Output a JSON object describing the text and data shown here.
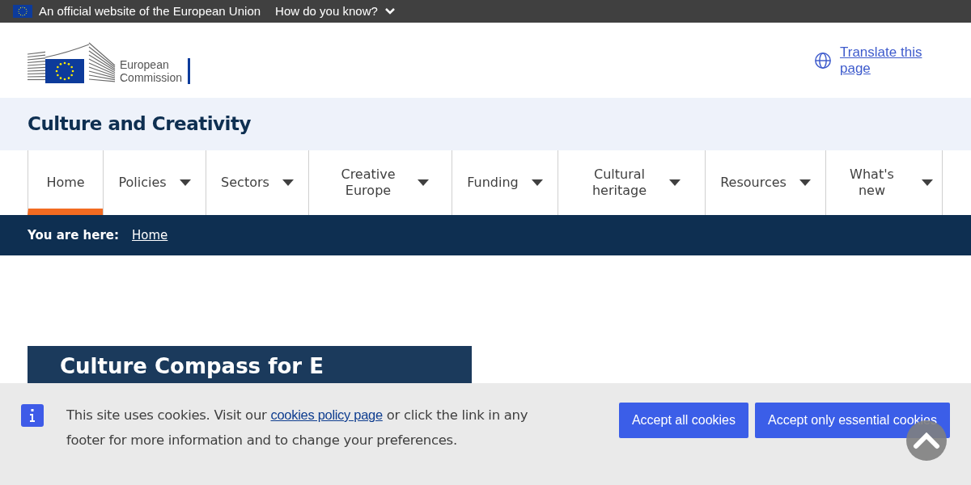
{
  "top_bar": {
    "text": "An official website of the European Union",
    "toggle": "How do you know?"
  },
  "header": {
    "logo_text": [
      "European",
      "Commission"
    ],
    "translate_link": "Translate this page"
  },
  "site_name": "Culture and Creativity",
  "nav": [
    {
      "label": "Home",
      "selected": true,
      "dropdown": false
    },
    {
      "label": "Policies",
      "selected": false,
      "dropdown": true
    },
    {
      "label": "Sectors",
      "selected": false,
      "dropdown": true
    },
    {
      "label": "Creative Europe",
      "selected": false,
      "dropdown": true
    },
    {
      "label": "Funding",
      "selected": false,
      "dropdown": true
    },
    {
      "label": "Cultural heritage",
      "selected": false,
      "dropdown": true
    },
    {
      "label": "Resources",
      "selected": false,
      "dropdown": true
    },
    {
      "label": "What's new",
      "selected": false,
      "dropdown": true
    }
  ],
  "breadcrumb": {
    "label": "You are here:",
    "items": [
      "Home"
    ]
  },
  "hero": {
    "title": "Culture Compass for E"
  },
  "cookie_banner": {
    "text_before": "This site uses cookies. Visit our",
    "link": "cookies policy page",
    "text_after": "or click the link in any footer for more information and to change your preferences.",
    "buttons": [
      "Accept all cookies",
      "Accept only essential cookies"
    ]
  }
}
